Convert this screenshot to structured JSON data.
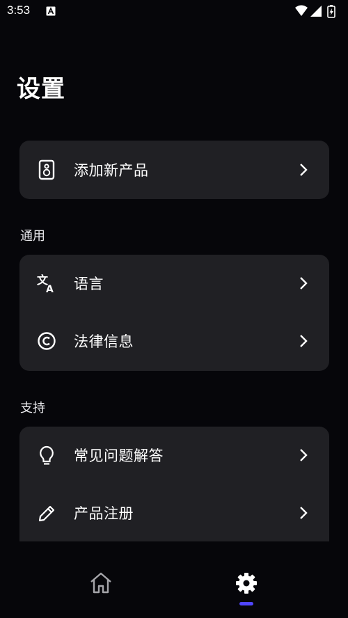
{
  "status_bar": {
    "time": "3:53"
  },
  "page": {
    "title": "设置"
  },
  "top_card": {
    "items": [
      {
        "label": "添加新产品",
        "icon": "speaker-device-icon"
      }
    ]
  },
  "general": {
    "heading": "通用",
    "items": [
      {
        "label": "语言",
        "icon": "translate-icon"
      },
      {
        "label": "法律信息",
        "icon": "copyright-icon"
      }
    ]
  },
  "support": {
    "heading": "支持",
    "items": [
      {
        "label": "常见问题解答",
        "icon": "lightbulb-icon"
      },
      {
        "label": "产品注册",
        "icon": "pencil-icon"
      }
    ]
  },
  "bottom_nav": {
    "items": [
      {
        "icon": "home-icon",
        "active": false
      },
      {
        "icon": "gear-icon",
        "active": true
      }
    ],
    "accent_color": "#5046ff"
  }
}
